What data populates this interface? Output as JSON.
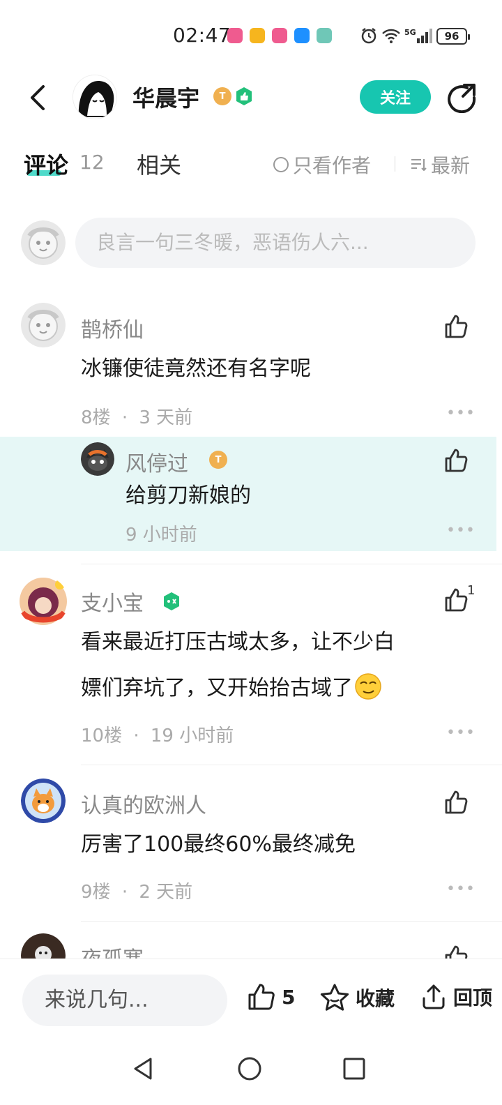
{
  "status_bar": {
    "time": "02:47",
    "battery": "96",
    "network": "5G",
    "notification_colors": [
      "#ef5b8f",
      "#f6b51e",
      "#ef5b8f",
      "#1e90ff",
      "#6fc7b7"
    ]
  },
  "header": {
    "author_name": "华晨宇",
    "level_badge": "T",
    "follow_label": "关注"
  },
  "tabs": {
    "comments_label": "评论",
    "comments_count": "12",
    "related_label": "相关",
    "only_author_label": "只看作者",
    "sort_label": "最新"
  },
  "reply_box": {
    "placeholder": "良言一句三冬暖，恶语伤人六..."
  },
  "comments": [
    {
      "name": "鹊桥仙",
      "body": "冰镰使徒竟然还有名字呢",
      "floor": "8楼",
      "time": "3 天前",
      "likes": ""
    },
    {
      "name": "支小宝",
      "body_line1": "看来最近打压古域太多，让不少白",
      "body_line2": "嫖们弃坑了，又开始抬古域了",
      "floor": "10楼",
      "time": "19 小时前",
      "likes": "1"
    },
    {
      "name": "认真的欧洲人",
      "body": "厉害了100最终60%最终减免",
      "floor": "9楼",
      "time": "2 天前",
      "likes": ""
    },
    {
      "name": "夜孤寒"
    }
  ],
  "reply": {
    "name": "风停过",
    "level_badge": "T",
    "body": "给剪刀新娘的",
    "time": "9 小时前"
  },
  "meta_separator": "·",
  "bottom_bar": {
    "input_placeholder": "来说几句...",
    "like_count": "5",
    "favorite_label": "收藏",
    "top_label": "回顶"
  },
  "colors": {
    "accent": "#17c6b0",
    "reply_bg": "#e6f7f6",
    "level_badge": "#f0b050",
    "vip_green": "#22c07a"
  }
}
